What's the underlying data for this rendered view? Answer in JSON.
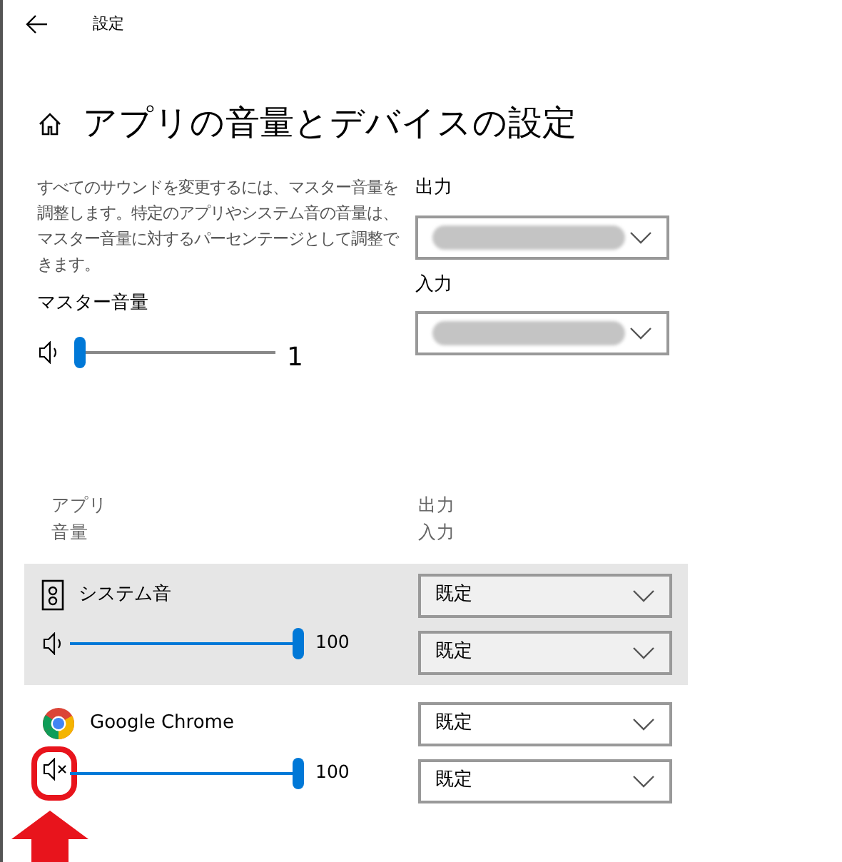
{
  "window": {
    "title": "設定"
  },
  "page_title": "アプリの音量とデバイスの設定",
  "description": "すべてのサウンドを変更するには、マスター音量を調整します。特定のアプリやシステム音の音量は、マスター音量に対するパーセンテージとして調整できます。",
  "master_volume": {
    "label": "マスター音量",
    "muted": false,
    "level": 0.02,
    "reading": "1"
  },
  "devices": [
    {
      "label": "出力",
      "value_hidden": true
    },
    {
      "label": "入力",
      "value_hidden": true
    }
  ],
  "apps_header": {
    "app": "アプリ",
    "volume": "音量",
    "output": "出力",
    "input": "入力"
  },
  "apps": [
    {
      "name": "システム音",
      "kind": "system",
      "selected": true,
      "muted": false,
      "level": 1,
      "reading": "100",
      "output": "既定",
      "input": "既定",
      "highlighted": false
    },
    {
      "name": "Google Chrome",
      "kind": "browser",
      "selected": false,
      "muted": true,
      "level": 1,
      "reading": "100",
      "output": "既定",
      "input": "既定",
      "highlighted": true
    }
  ]
}
